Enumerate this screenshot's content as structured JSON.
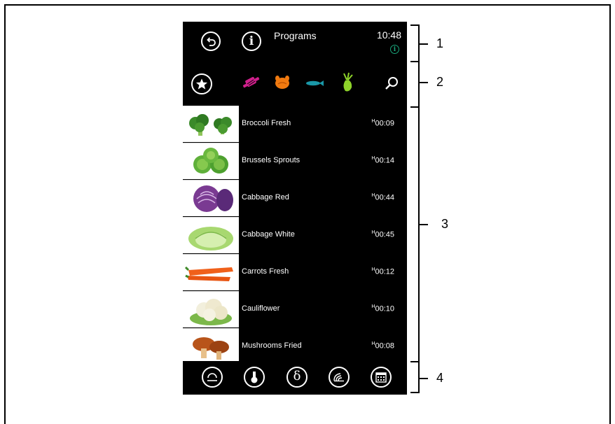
{
  "header": {
    "title": "Programs",
    "time": "10:48"
  },
  "callouts": [
    "1",
    "2",
    "3",
    "4"
  ],
  "colors": {
    "accent_green": "#1aa57a",
    "meat": "#d0208c",
    "poultry": "#f07a10",
    "fish": "#1a98a8",
    "vegetable": "#8ed32a"
  },
  "top_icons": [
    "back-icon",
    "info-icon",
    "info-small-icon"
  ],
  "category_icons": [
    "favorites-star-icon",
    "meat-icon",
    "poultry-icon",
    "fish-icon",
    "vegetable-icon",
    "search-icon"
  ],
  "programs": [
    {
      "name": "Broccoli Fresh",
      "time": "00:09",
      "image": "broccoli"
    },
    {
      "name": "Brussels Sprouts",
      "time": "00:14",
      "image": "brussels-sprouts"
    },
    {
      "name": "Cabbage Red",
      "time": "00:44",
      "image": "red-cabbage"
    },
    {
      "name": "Cabbage White",
      "time": "00:45",
      "image": "white-cabbage"
    },
    {
      "name": "Carrots Fresh",
      "time": "00:12",
      "image": "carrots"
    },
    {
      "name": "Cauliflower",
      "time": "00:10",
      "image": "cauliflower"
    },
    {
      "name": "Mushrooms Fried",
      "time": "00:08",
      "image": "mushrooms"
    }
  ],
  "time_prefix": "H",
  "bottom_icons": [
    "home-mode-icon",
    "temperature-mode-icon",
    "delta-mode-icon",
    "steam-mode-icon",
    "calendar-icon"
  ]
}
